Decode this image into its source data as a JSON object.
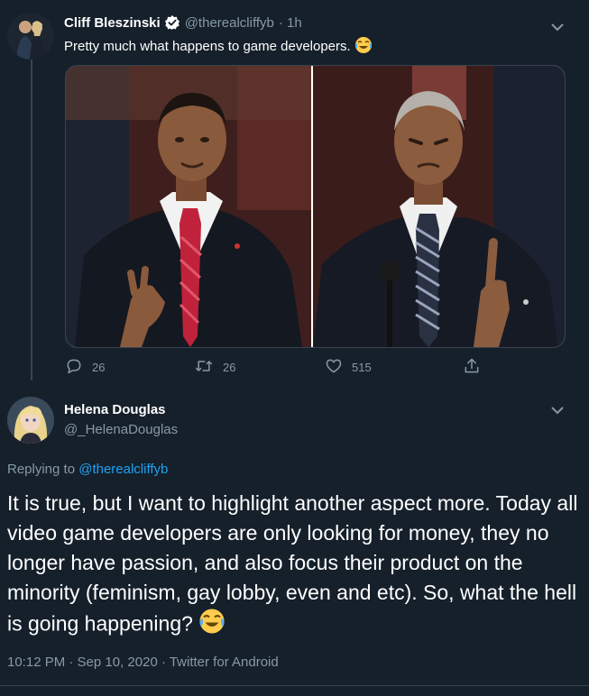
{
  "tweet1": {
    "name": "Cliff Bleszinski",
    "handle": "@therealcliffyb",
    "time": "· 1h",
    "text": "Pretty much what happens to game developers.",
    "emoji": "joy-emoji",
    "actions": {
      "reply_count": "26",
      "retweet_count": "26",
      "like_count": "515"
    }
  },
  "tweet2": {
    "name": "Helena Douglas",
    "handle": "@_HelenaDouglas",
    "replying_prefix": "Replying to",
    "replying_handle": "@therealcliffyb",
    "text": "It is true, but I want to highlight another aspect more. Today all video game developers are only looking for money, they no longer have passion, and also focus their product on the minority (feminism, gay lobby, even and etc). So, what the hell is going happening?",
    "emoji": "joy-emoji",
    "meta": "10:12 PM · Sep 10, 2020 · Twitter for Android"
  },
  "colors": {
    "background": "#15202b",
    "secondary_text": "#8899a6",
    "link": "#1da1f2",
    "verified": "#1da1f2",
    "divider": "#38444d"
  },
  "icons": [
    "verified-badge-icon",
    "chevron-down-icon",
    "reply-icon",
    "retweet-icon",
    "like-icon",
    "share-icon"
  ]
}
